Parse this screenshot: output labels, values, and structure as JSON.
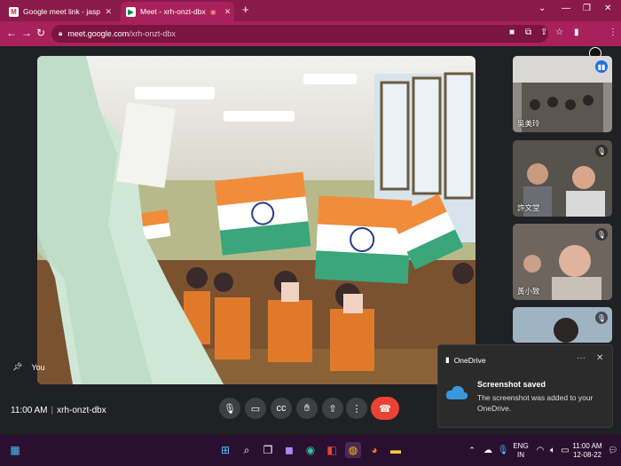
{
  "browser": {
    "tabs": [
      {
        "label": "Google meet link - jaspreet.k@",
        "icon": "gmail-icon",
        "active": false
      },
      {
        "label": "Meet - xrh-onzt-dbx",
        "icon": "meet-icon",
        "active": true
      }
    ],
    "url_host": "meet.google.com",
    "url_path": "/xrh-onzt-dbx"
  },
  "meeting": {
    "self_label": "You",
    "time": "11:00 AM",
    "code": "xrh-onzt-dbx",
    "participants": [
      {
        "name": "吳美玲",
        "speaking": true
      },
      {
        "name": "許文堂",
        "speaking": false
      },
      {
        "name": "黃小致",
        "speaking": false
      },
      {
        "name": "",
        "speaking": false
      }
    ]
  },
  "notification": {
    "app": "OneDrive",
    "title": "Screenshot saved",
    "message": "The screenshot was added to your OneDrive."
  },
  "taskbar": {
    "lang_line1": "ENG",
    "lang_line2": "IN",
    "clock_time": "11:00 AM",
    "clock_date": "12-08-22"
  },
  "colors": {
    "browser_frame": "#a8215a",
    "meet_bg": "#202124",
    "end_call": "#ea4335",
    "active_speaker": "#1a73e8"
  }
}
